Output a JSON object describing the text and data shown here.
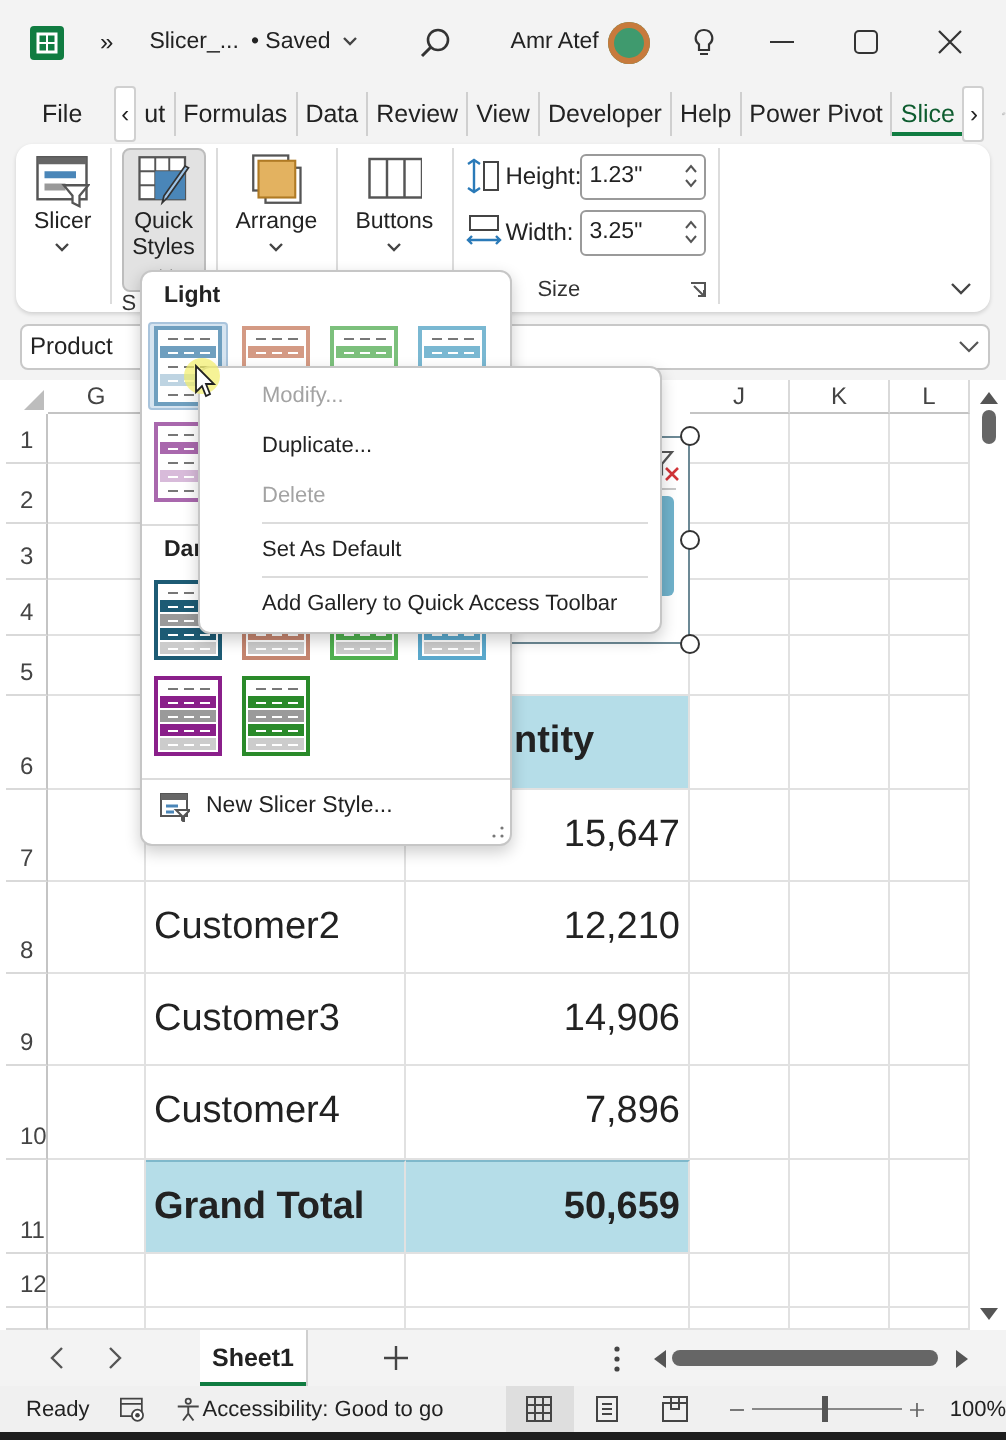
{
  "title_bar": {
    "overflow": "»",
    "file_name": "Slicer_...",
    "save_state": "• Saved",
    "user": "Amr Atef"
  },
  "ribbon_tabs": [
    {
      "label": "File",
      "selected": false
    },
    {
      "label": "ut",
      "selected": false
    },
    {
      "label": "Formulas",
      "selected": false
    },
    {
      "label": "Data",
      "selected": false
    },
    {
      "label": "Review",
      "selected": false
    },
    {
      "label": "View",
      "selected": false
    },
    {
      "label": "Developer",
      "selected": false
    },
    {
      "label": "Help",
      "selected": false
    },
    {
      "label": "Power Pivot",
      "selected": false
    },
    {
      "label": "Slice",
      "selected": true
    }
  ],
  "tab_scroll": {
    "left": "‹",
    "right": "›"
  },
  "ribbon": {
    "groups": [
      {
        "buttons": [
          {
            "label": "Slicer",
            "selected": false
          }
        ]
      },
      {
        "label": "S",
        "buttons": [
          {
            "label": "Quick Styles",
            "selected": true
          }
        ]
      },
      {
        "buttons": [
          {
            "label": "Arrange",
            "selected": false
          }
        ]
      },
      {
        "buttons": [
          {
            "label": "Buttons",
            "selected": false
          }
        ]
      },
      {
        "label": "Size",
        "fields": [
          {
            "kind": "height",
            "label": "Height:",
            "value": "1.23\""
          },
          {
            "kind": "width",
            "label": "Width:",
            "value": "3.25\""
          }
        ]
      }
    ]
  },
  "name_box": {
    "value": "Product"
  },
  "columns": [
    "G",
    "J",
    "K",
    "L"
  ],
  "row_numbers": [
    "1",
    "2",
    "3",
    "4",
    "5",
    "6",
    "7",
    "8",
    "9",
    "10",
    "11",
    "12"
  ],
  "pivot_table": {
    "header": "ntity",
    "rows": [
      {
        "value": "15,647",
        "total": false
      },
      {
        "label": "Customer2",
        "value": "12,210",
        "total": false
      },
      {
        "label": "Customer3",
        "value": "14,906",
        "total": false
      },
      {
        "label": "Customer4",
        "value": "7,896",
        "total": false
      },
      {
        "label": "Grand Total",
        "value": "50,659",
        "total": true
      }
    ]
  },
  "slicer": {
    "selected": true
  },
  "style_gallery": {
    "sections": [
      {
        "title": "Light",
        "kind": "light",
        "styles": [
          {
            "color": "#6f9fbf",
            "selected": true
          },
          {
            "color": "#d49a84",
            "selected": false
          },
          {
            "color": "#7cc07c",
            "selected": false
          },
          {
            "color": "#7ab8d2",
            "selected": false
          },
          {
            "color": "#a968ad",
            "selected": false
          }
        ]
      },
      {
        "title": "Dar",
        "kind": "dark",
        "styles": [
          {
            "color": "#1d5b74",
            "selected": false
          },
          {
            "color": "#c4856f",
            "selected": false
          },
          {
            "color": "#4faf4f",
            "selected": false
          },
          {
            "color": "#5aa8cc",
            "selected": false
          },
          {
            "color": "#8a1f8a",
            "selected": false
          },
          {
            "color": "#2a8a2a",
            "selected": false
          }
        ]
      }
    ],
    "new_style": "New Slicer Style..."
  },
  "context_menu": {
    "items": [
      {
        "kind": "item",
        "label": "Modify...",
        "disabled": true
      },
      {
        "kind": "item",
        "label": "Duplicate...",
        "disabled": false
      },
      {
        "kind": "item",
        "label": "Delete",
        "disabled": true
      },
      {
        "kind": "separator"
      },
      {
        "kind": "item",
        "label": "Set As Default",
        "disabled": false
      },
      {
        "kind": "separator"
      },
      {
        "kind": "item",
        "label": "Add Gallery to Quick Access Toolbar",
        "disabled": false
      }
    ]
  },
  "sheet_tabs": [
    {
      "label": "Sheet1",
      "selected": true
    }
  ],
  "status_bar": {
    "status": "Ready",
    "accessibility": "Accessibility: Good to go",
    "views": [
      {
        "kind": "normal",
        "selected": true
      },
      {
        "kind": "page-layout",
        "selected": false
      },
      {
        "kind": "page-break",
        "selected": false
      }
    ],
    "zoom": {
      "level": 0.5,
      "reading": "100%"
    }
  }
}
